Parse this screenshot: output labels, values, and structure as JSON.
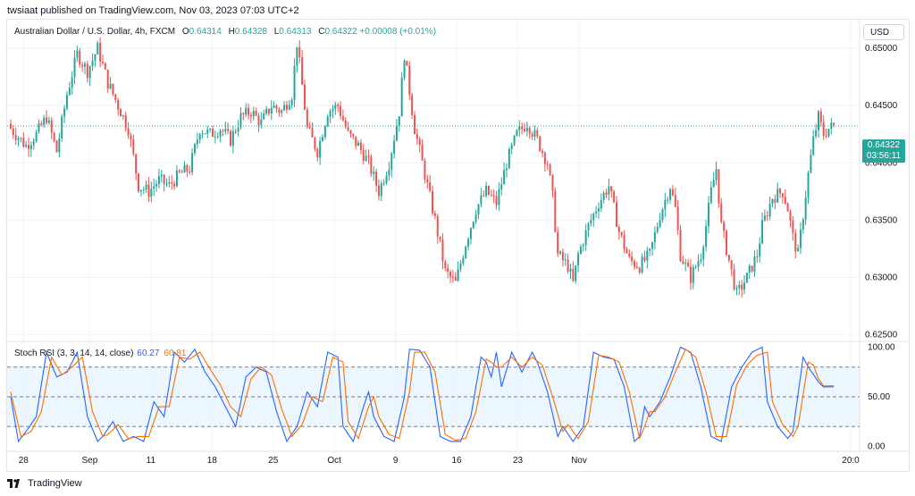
{
  "publisher": "twsiaat published on TradingView.com, Nov 03, 2023 07:03 UTC+2",
  "legend": {
    "symbol": "Australian Dollar / U.S. Dollar, 4h, FXCM",
    "open_label": "O",
    "open": "0.64314",
    "high_label": "H",
    "high": "0.64328",
    "low_label": "L",
    "low": "0.64313",
    "close_label": "C",
    "close": "0.64322",
    "change": "+0.00008 (+0.01%)"
  },
  "currency_button": "USD",
  "price_tag": {
    "price": "0.64322",
    "countdown": "03:56:11"
  },
  "rsi_legend": {
    "name": "Stoch RSI (3, 3, 14, 14, close)",
    "k": "60.27",
    "d": "60.81"
  },
  "footer": {
    "brand": "TradingView",
    "logo_icon": "tradingview-logo-icon"
  },
  "colors": {
    "up": "#26a69a",
    "down": "#ef5350",
    "k_line": "#2962ff",
    "d_line": "#ff6d00",
    "band": "#e3f2fd"
  },
  "chart_data": [
    {
      "type": "candlestick",
      "title": "Australian Dollar / U.S. Dollar, 4h, FXCM",
      "ylim": [
        0.6245,
        0.6525
      ],
      "y_ticks": [
        "0.65000",
        "0.64500",
        "0.64000",
        "0.63500",
        "0.63000",
        "0.62500"
      ],
      "y_tick_values": [
        0.65,
        0.645,
        0.64,
        0.635,
        0.63,
        0.625
      ],
      "x_tick_labels": [
        "28",
        "Sep",
        "11",
        "18",
        "25",
        "Oct",
        "9",
        "16",
        "23",
        "Nov",
        "20:0"
      ],
      "last_price": 0.64322,
      "anchors": [
        [
          0,
          0.643
        ],
        [
          6,
          0.6415
        ],
        [
          10,
          0.6425
        ],
        [
          14,
          0.644
        ],
        [
          18,
          0.641
        ],
        [
          22,
          0.646
        ],
        [
          26,
          0.6495
        ],
        [
          30,
          0.648
        ],
        [
          34,
          0.65
        ],
        [
          38,
          0.647
        ],
        [
          42,
          0.645
        ],
        [
          46,
          0.643
        ],
        [
          50,
          0.638
        ],
        [
          54,
          0.6375
        ],
        [
          58,
          0.6385
        ],
        [
          62,
          0.638
        ],
        [
          66,
          0.639
        ],
        [
          70,
          0.6395
        ],
        [
          74,
          0.643
        ],
        [
          78,
          0.6425
        ],
        [
          82,
          0.643
        ],
        [
          86,
          0.642
        ],
        [
          90,
          0.644
        ],
        [
          94,
          0.6445
        ],
        [
          98,
          0.6435
        ],
        [
          102,
          0.645
        ],
        [
          106,
          0.6445
        ],
        [
          110,
          0.646
        ],
        [
          112,
          0.6505
        ],
        [
          116,
          0.643
        ],
        [
          120,
          0.641
        ],
        [
          124,
          0.6445
        ],
        [
          128,
          0.645
        ],
        [
          132,
          0.6425
        ],
        [
          136,
          0.6415
        ],
        [
          140,
          0.64
        ],
        [
          144,
          0.6375
        ],
        [
          148,
          0.64
        ],
        [
          152,
          0.6445
        ],
        [
          154,
          0.6495
        ],
        [
          158,
          0.643
        ],
        [
          162,
          0.639
        ],
        [
          166,
          0.635
        ],
        [
          170,
          0.6305
        ],
        [
          174,
          0.6295
        ],
        [
          178,
          0.633
        ],
        [
          182,
          0.636
        ],
        [
          186,
          0.6375
        ],
        [
          190,
          0.6365
        ],
        [
          194,
          0.64
        ],
        [
          198,
          0.6425
        ],
        [
          202,
          0.6435
        ],
        [
          206,
          0.642
        ],
        [
          210,
          0.64
        ],
        [
          212,
          0.637
        ],
        [
          214,
          0.632
        ],
        [
          218,
          0.631
        ],
        [
          220,
          0.6295
        ],
        [
          222,
          0.632
        ],
        [
          226,
          0.6345
        ],
        [
          230,
          0.6365
        ],
        [
          234,
          0.638
        ],
        [
          238,
          0.634
        ],
        [
          242,
          0.6315
        ],
        [
          246,
          0.631
        ],
        [
          250,
          0.632
        ],
        [
          254,
          0.6355
        ],
        [
          258,
          0.638
        ],
        [
          260,
          0.636
        ],
        [
          262,
          0.632
        ],
        [
          266,
          0.63
        ],
        [
          270,
          0.632
        ],
        [
          272,
          0.6345
        ],
        [
          274,
          0.6375
        ],
        [
          276,
          0.6395
        ],
        [
          278,
          0.6345
        ],
        [
          282,
          0.6305
        ],
        [
          284,
          0.6285
        ],
        [
          288,
          0.63
        ],
        [
          292,
          0.632
        ],
        [
          294,
          0.6345
        ],
        [
          298,
          0.637
        ],
        [
          302,
          0.6375
        ],
        [
          304,
          0.636
        ],
        [
          306,
          0.6335
        ],
        [
          308,
          0.632
        ],
        [
          312,
          0.639
        ],
        [
          314,
          0.642
        ],
        [
          316,
          0.644
        ],
        [
          318,
          0.6425
        ],
        [
          320,
          0.643
        ],
        [
          322,
          0.6432
        ]
      ]
    },
    {
      "type": "line",
      "title": "Stoch RSI (3, 3, 14, 14, close)",
      "ylim": [
        -5,
        105
      ],
      "y_ticks": [
        "100.00",
        "50.00",
        "0.00"
      ],
      "y_tick_values": [
        100,
        50,
        0
      ],
      "bands": [
        80,
        50,
        20
      ],
      "series": [
        {
          "name": "K",
          "value": "60.27",
          "anchors": [
            [
              0,
              50
            ],
            [
              3,
              5
            ],
            [
              6,
              15
            ],
            [
              10,
              30
            ],
            [
              14,
              95
            ],
            [
              18,
              70
            ],
            [
              22,
              75
            ],
            [
              26,
              95
            ],
            [
              30,
              30
            ],
            [
              34,
              5
            ],
            [
              36,
              10
            ],
            [
              40,
              25
            ],
            [
              44,
              5
            ],
            [
              48,
              10
            ],
            [
              52,
              5
            ],
            [
              56,
              45
            ],
            [
              60,
              30
            ],
            [
              64,
              95
            ],
            [
              68,
              85
            ],
            [
              72,
              98
            ],
            [
              76,
              75
            ],
            [
              80,
              60
            ],
            [
              84,
              40
            ],
            [
              88,
              20
            ],
            [
              92,
              70
            ],
            [
              96,
              80
            ],
            [
              100,
              75
            ],
            [
              104,
              35
            ],
            [
              108,
              5
            ],
            [
              112,
              20
            ],
            [
              116,
              55
            ],
            [
              120,
              40
            ],
            [
              124,
              95
            ],
            [
              128,
              90
            ],
            [
              130,
              20
            ],
            [
              134,
              5
            ],
            [
              138,
              40
            ],
            [
              140,
              55
            ],
            [
              142,
              30
            ],
            [
              146,
              10
            ],
            [
              150,
              5
            ],
            [
              154,
              50
            ],
            [
              156,
              98
            ],
            [
              160,
              97
            ],
            [
              164,
              80
            ],
            [
              168,
              10
            ],
            [
              172,
              5
            ],
            [
              176,
              5
            ],
            [
              180,
              30
            ],
            [
              184,
              90
            ],
            [
              186,
              85
            ],
            [
              188,
              70
            ],
            [
              190,
              95
            ],
            [
              192,
              60
            ],
            [
              196,
              95
            ],
            [
              200,
              75
            ],
            [
              204,
              95
            ],
            [
              206,
              85
            ],
            [
              210,
              55
            ],
            [
              214,
              10
            ],
            [
              216,
              20
            ],
            [
              220,
              5
            ],
            [
              224,
              20
            ],
            [
              228,
              95
            ],
            [
              232,
              90
            ],
            [
              236,
              88
            ],
            [
              240,
              60
            ],
            [
              244,
              5
            ],
            [
              246,
              10
            ],
            [
              248,
              40
            ],
            [
              250,
              30
            ],
            [
              254,
              45
            ],
            [
              258,
              70
            ],
            [
              262,
              100
            ],
            [
              266,
              95
            ],
            [
              270,
              60
            ],
            [
              274,
              10
            ],
            [
              278,
              5
            ],
            [
              282,
              60
            ],
            [
              286,
              80
            ],
            [
              290,
              95
            ],
            [
              294,
              100
            ],
            [
              296,
              45
            ],
            [
              300,
              20
            ],
            [
              304,
              8
            ],
            [
              306,
              15
            ],
            [
              310,
              90
            ],
            [
              312,
              80
            ],
            [
              316,
              65
            ],
            [
              318,
              60
            ]
          ]
        },
        {
          "name": "D",
          "value": "60.81",
          "anchors": [
            [
              0,
              55
            ],
            [
              4,
              10
            ],
            [
              8,
              15
            ],
            [
              12,
              35
            ],
            [
              16,
              90
            ],
            [
              20,
              72
            ],
            [
              24,
              80
            ],
            [
              28,
              90
            ],
            [
              32,
              35
            ],
            [
              36,
              10
            ],
            [
              38,
              12
            ],
            [
              42,
              22
            ],
            [
              46,
              8
            ],
            [
              50,
              10
            ],
            [
              54,
              10
            ],
            [
              58,
              40
            ],
            [
              62,
              40
            ],
            [
              66,
              90
            ],
            [
              70,
              88
            ],
            [
              74,
              95
            ],
            [
              78,
              78
            ],
            [
              82,
              62
            ],
            [
              86,
              40
            ],
            [
              90,
              30
            ],
            [
              94,
              68
            ],
            [
              98,
              80
            ],
            [
              102,
              72
            ],
            [
              106,
              38
            ],
            [
              110,
              10
            ],
            [
              114,
              22
            ],
            [
              118,
              50
            ],
            [
              122,
              45
            ],
            [
              126,
              90
            ],
            [
              130,
              85
            ],
            [
              132,
              25
            ],
            [
              136,
              8
            ],
            [
              140,
              40
            ],
            [
              142,
              50
            ],
            [
              144,
              30
            ],
            [
              148,
              12
            ],
            [
              152,
              8
            ],
            [
              156,
              55
            ],
            [
              158,
              95
            ],
            [
              162,
              95
            ],
            [
              166,
              75
            ],
            [
              170,
              12
            ],
            [
              174,
              6
            ],
            [
              178,
              8
            ],
            [
              182,
              35
            ],
            [
              186,
              88
            ],
            [
              188,
              85
            ],
            [
              190,
              80
            ],
            [
              192,
              80
            ],
            [
              196,
              90
            ],
            [
              200,
              80
            ],
            [
              204,
              90
            ],
            [
              208,
              82
            ],
            [
              212,
              50
            ],
            [
              216,
              15
            ],
            [
              218,
              22
            ],
            [
              222,
              8
            ],
            [
              226,
              25
            ],
            [
              230,
              92
            ],
            [
              234,
              90
            ],
            [
              238,
              85
            ],
            [
              242,
              55
            ],
            [
              246,
              8
            ],
            [
              248,
              20
            ],
            [
              250,
              35
            ],
            [
              252,
              35
            ],
            [
              256,
              50
            ],
            [
              260,
              75
            ],
            [
              264,
              98
            ],
            [
              268,
              90
            ],
            [
              272,
              55
            ],
            [
              276,
              10
            ],
            [
              280,
              10
            ],
            [
              284,
              62
            ],
            [
              288,
              82
            ],
            [
              292,
              92
            ],
            [
              296,
              95
            ],
            [
              298,
              45
            ],
            [
              302,
              22
            ],
            [
              306,
              10
            ],
            [
              308,
              20
            ],
            [
              312,
              85
            ],
            [
              314,
              82
            ],
            [
              316,
              68
            ],
            [
              318,
              61
            ]
          ]
        }
      ]
    }
  ]
}
